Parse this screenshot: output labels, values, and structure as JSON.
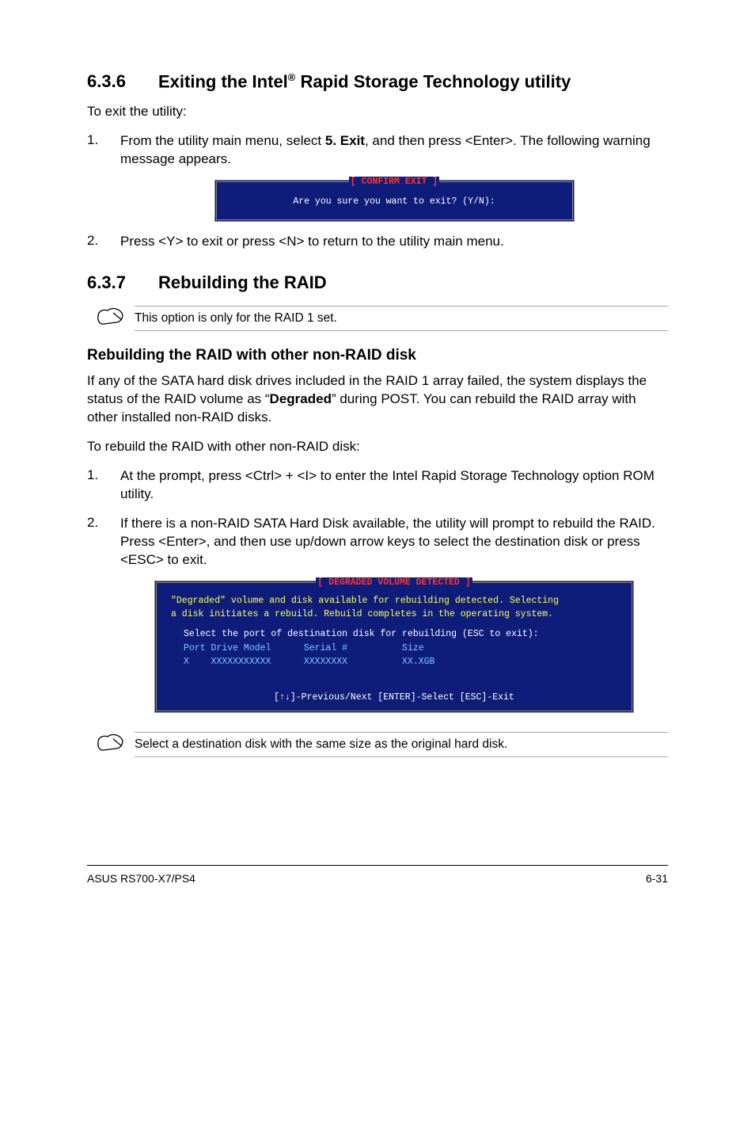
{
  "section_636": {
    "num": "6.3.6",
    "title_a": "Exiting the Intel",
    "title_sup": "®",
    "title_b": " Rapid Storage Technology utility",
    "intro": "To exit the utility:",
    "step1_n": "1.",
    "step1_a": "From the utility main menu, select ",
    "step1_bold": "5. Exit",
    "step1_b": ", and then press <Enter>. The following warning message appears.",
    "bios_title": "[ CONFIRM EXIT ]",
    "bios_line": "Are you sure you want to exit? (Y/N):",
    "step2_n": "2.",
    "step2": "Press <Y> to exit or press <N> to return to the utility main menu."
  },
  "section_637": {
    "num": "6.3.7",
    "title": "Rebuilding the RAID",
    "note1": "This option is only for the RAID 1 set.",
    "sub_h": "Rebuilding the RAID with other non-RAID disk",
    "p1_a": "If any of the SATA hard disk drives included in the RAID 1 array failed, the system displays the status of the RAID volume as “",
    "p1_bold": "Degraded",
    "p1_b": "” during POST. You can rebuild the RAID array with other installed non-RAID disks.",
    "p2": "To rebuild the RAID with other non-RAID disk:",
    "step1_n": "1.",
    "step1": "At the prompt, press <Ctrl> + <I> to enter the Intel Rapid Storage Technology option ROM utility.",
    "step2_n": "2.",
    "step2": "If there is a non-RAID SATA Hard Disk available, the utility will prompt to rebuild the RAID. Press <Enter>, and then use up/down arrow keys to select the destination disk or press <ESC> to exit.",
    "bios": {
      "title": "[ DEGRADED VOLUME DETECTED ]",
      "l1": "\"Degraded\" volume and disk available for rebuilding detected. Selecting",
      "l2": "a disk initiates a rebuild. Rebuild completes in the operating system.",
      "l3": "Select the port of destination disk for rebuilding (ESC to exit):",
      "hdr": "Port Drive Model      Serial #          Size",
      "row": "X    XXXXXXXXXXX      XXXXXXXX          XX.XGB",
      "footer": "[↑↓]-Previous/Next  [ENTER]-Select  [ESC]-Exit"
    },
    "note2": "Select a destination disk with the same size as the original hard disk."
  },
  "footer": {
    "left": "ASUS RS700-X7/PS4",
    "right": "6-31"
  }
}
